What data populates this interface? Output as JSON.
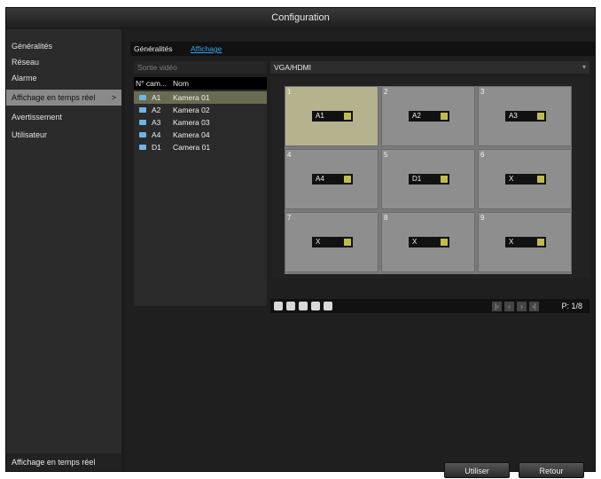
{
  "window": {
    "title": "Configuration"
  },
  "sidebar": {
    "items": [
      {
        "label": "Généralités"
      },
      {
        "label": "Réseau"
      },
      {
        "label": "Alarme"
      },
      {
        "label": "Affichage en temps réel",
        "arrow": ">"
      },
      {
        "label": "Avertissement"
      },
      {
        "label": "Utilisateur"
      }
    ],
    "bottom_label": "Affichage en temps réel"
  },
  "tabs": [
    {
      "label": "Généralités"
    },
    {
      "label": "Affichage"
    }
  ],
  "video_output": {
    "label": "Sortie vidéo",
    "value": "VGA/HDMI"
  },
  "camera_table": {
    "headers": {
      "id": "N° cam...",
      "name": "Nom"
    },
    "rows": [
      {
        "id": "A1",
        "name": "Kamera 01"
      },
      {
        "id": "A2",
        "name": "Kamera 02"
      },
      {
        "id": "A3",
        "name": "Kamera 03"
      },
      {
        "id": "A4",
        "name": "Kamera 04"
      },
      {
        "id": "D1",
        "name": "Camera 01"
      }
    ]
  },
  "layout_grid": {
    "cells": [
      {
        "num": "1",
        "cam": "A1"
      },
      {
        "num": "2",
        "cam": "A2"
      },
      {
        "num": "3",
        "cam": "A3"
      },
      {
        "num": "4",
        "cam": "A4"
      },
      {
        "num": "5",
        "cam": "D1"
      },
      {
        "num": "6",
        "cam": "X"
      },
      {
        "num": "7",
        "cam": "X"
      },
      {
        "num": "8",
        "cam": "X"
      },
      {
        "num": "9",
        "cam": "X"
      }
    ]
  },
  "toolbar": {
    "page_indicator": "P: 1/8"
  },
  "buttons": {
    "apply": "Utiliser",
    "back": "Retour"
  }
}
